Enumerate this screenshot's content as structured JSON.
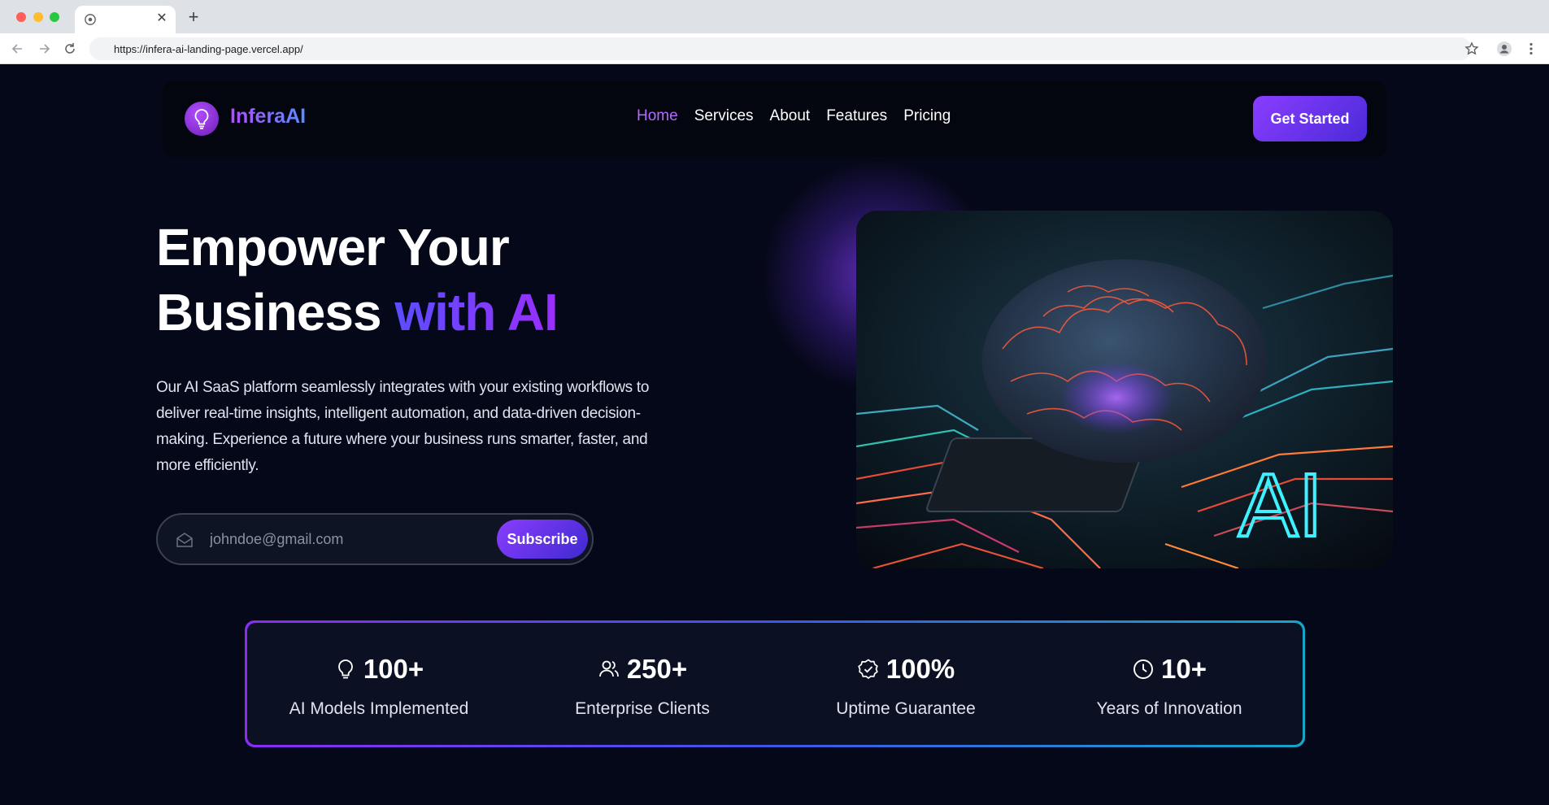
{
  "browser": {
    "url": "https://infera-ai-landing-page.vercel.app/",
    "tab_close": "✕",
    "new_tab": "+"
  },
  "brand": {
    "name": "InferaAI"
  },
  "nav": {
    "links": [
      {
        "label": "Home",
        "active": true
      },
      {
        "label": "Services"
      },
      {
        "label": "About"
      },
      {
        "label": "Features"
      },
      {
        "label": "Pricing"
      }
    ],
    "cta": "Get Started"
  },
  "hero": {
    "title_line1": "Empower Your",
    "title_line2_plain": "Business",
    "title_line2_accent": "with AI",
    "description": "Our AI SaaS platform seamlessly integrates with your existing workflows to deliver real-time insights, intelligent automation, and data-driven decision-making. Experience a future where your business runs smarter, faster, and more efficiently.",
    "email_placeholder": "johndoe@gmail.com",
    "subscribe_label": "Subscribe",
    "image_text": "AI"
  },
  "stats": [
    {
      "icon": "lightbulb-icon",
      "value": "100+",
      "label": "AI Models Implemented"
    },
    {
      "icon": "users-icon",
      "value": "250+",
      "label": "Enterprise Clients"
    },
    {
      "icon": "badge-check-icon",
      "value": "100%",
      "label": "Uptime Guarantee"
    },
    {
      "icon": "clock-icon",
      "value": "10+",
      "label": "Years of Innovation"
    }
  ],
  "colors": {
    "page_bg": "#050818",
    "accent_purple": "#8a3dff",
    "accent_blue": "#4b2ad8",
    "nav_active": "#b36bff"
  }
}
